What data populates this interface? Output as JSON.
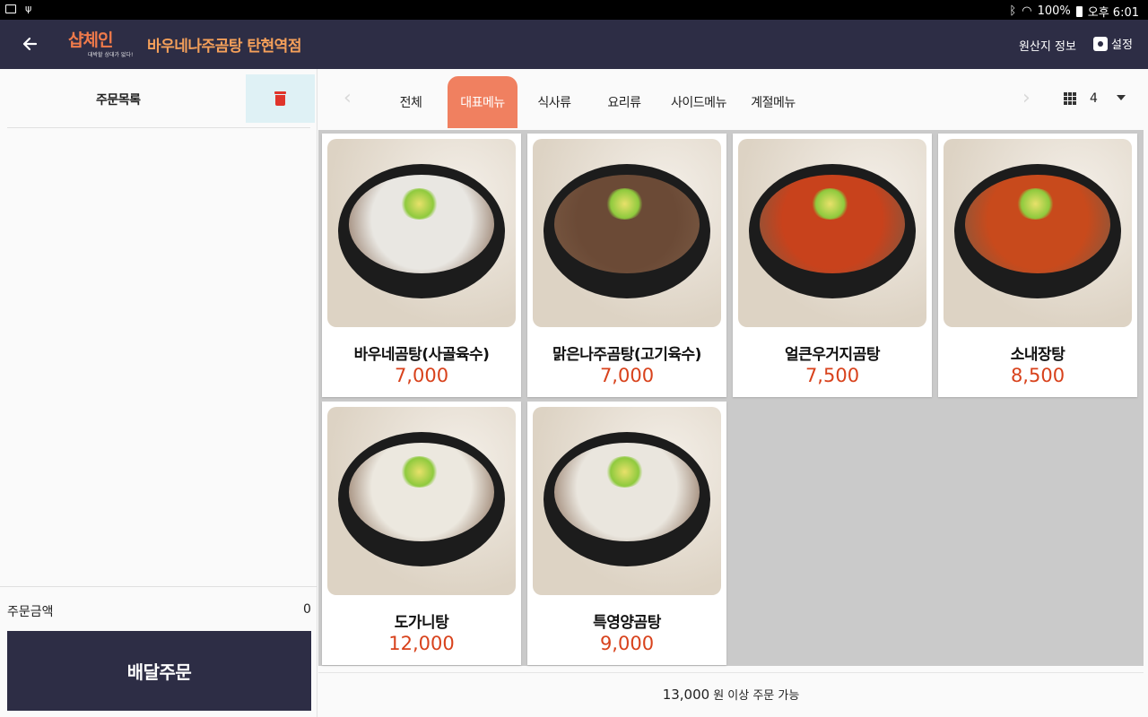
{
  "status_bar": {
    "battery": "100%",
    "time": "오후 6:01"
  },
  "header": {
    "logo_text": "샵체인",
    "logo_tagline": "대박할 상대가 없다!",
    "store_name": "바우네나주곰탕  탄현역점",
    "origin_info_label": "원산지 정보",
    "settings_label": "설정"
  },
  "order_panel": {
    "title": "주문목록",
    "total_label": "주문금액",
    "total_value": "0",
    "delivery_button_label": "배달주문"
  },
  "tabs": {
    "items": [
      {
        "label": "전체"
      },
      {
        "label": "대표메뉴"
      },
      {
        "label": "식사류"
      },
      {
        "label": "요리류"
      },
      {
        "label": "사이드메뉴"
      },
      {
        "label": "계절메뉴"
      }
    ],
    "active_index": 1,
    "columns_value": "4"
  },
  "menu": {
    "items": [
      {
        "name": "바우네곰탕(사골육수)",
        "price": "7,000",
        "soup_color": "#e9e7e2"
      },
      {
        "name": "맑은나주곰탕(고기육수)",
        "price": "7,000",
        "soup_color": "#6b4a36"
      },
      {
        "name": "얼큰우거지곰탕",
        "price": "7,500",
        "soup_color": "#c8421c"
      },
      {
        "name": "소내장탕",
        "price": "8,500",
        "soup_color": "#c84a1c"
      },
      {
        "name": "도가니탕",
        "price": "12,000",
        "soup_color": "#ece8df"
      },
      {
        "name": "특영양곰탕",
        "price": "9,000",
        "soup_color": "#eae6de"
      }
    ]
  },
  "notice": {
    "amount": "13,000",
    "text": "원 이상 주문 가능"
  },
  "colors": {
    "header_bg": "#2d2d45",
    "accent": "#f08060",
    "price": "#d8421c",
    "store_name": "#f5a05a",
    "delete_bg": "#dff1f5",
    "trash": "#e0352b"
  }
}
